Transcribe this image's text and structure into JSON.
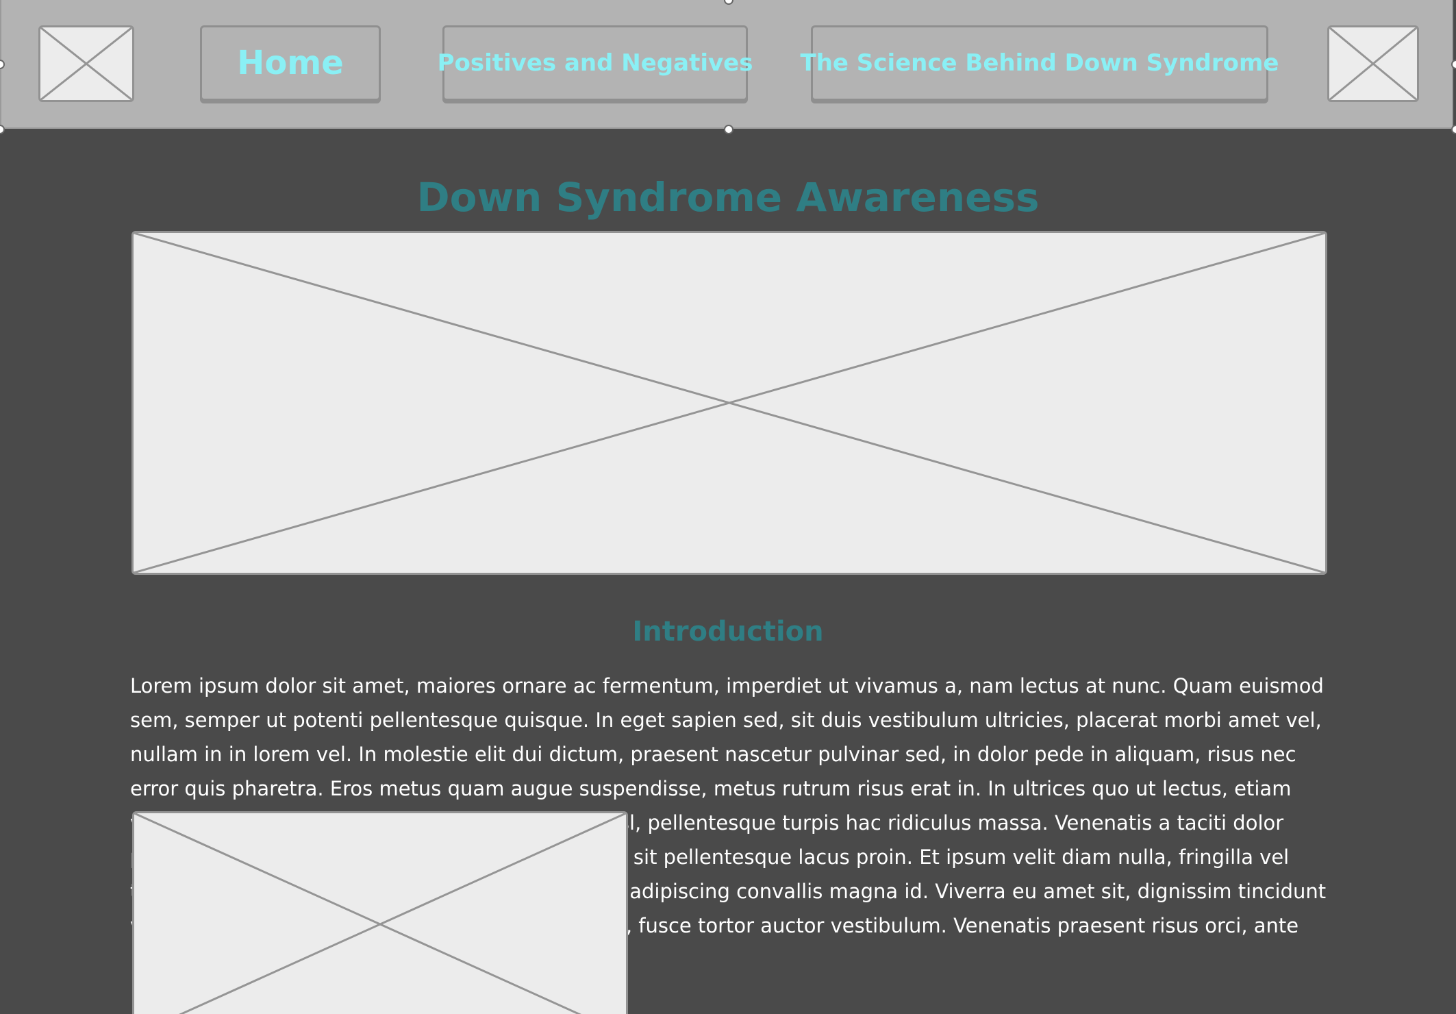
{
  "nav": {
    "home_label": "Home",
    "positives_label": "Positives and Negatives",
    "science_label": "The Science Behind Down Syndrome",
    "left_logo_icon": "image-placeholder-icon",
    "right_logo_icon": "image-placeholder-icon"
  },
  "main": {
    "title": "Down Syndrome Awareness",
    "hero_image_icon": "image-placeholder-icon",
    "intro_heading": "Introduction",
    "intro_text": "Lorem ipsum dolor sit amet, maiores ornare ac fermentum, imperdiet ut vivamus a, nam lectus at nunc. Quam euismod sem, semper ut potenti pellentesque quisque. In eget sapien sed, sit duis vestibulum ultricies, placerat morbi amet vel, nullam in in lorem vel. In molestie elit dui dictum, praesent nascetur pulvinar sed, in dolor pede in aliquam, risus nec error quis pharetra. Eros metus quam augue suspendisse, metus rutrum risus erat in. In ultrices quo ut lectus, etiam vestibulum urna a est, pretium luctus euismod nisl, pellentesque turpis hac ridiculus massa. Venenatis a taciti dolor platea, curabitur lorem platea urna odio, convallis sit pellentesque lacus proin. Et ipsum velit diam nulla, fringilla vel tincidunt vitae, elit turpis id sit, sapien quis purus adipiscing convallis magna id. Viverra eu amet sit, dignissim tincidunt volutpat nulla tincidunt, feugiat et nec ante tortor, fusce tortor auctor vestibulum. Venenatis praesent risus orci, ante",
    "inline_image_icon": "image-placeholder-icon"
  },
  "colors": {
    "nav_background": "#b3b3b3",
    "page_background": "#4a4a4a",
    "nav_text": "#8af0f5",
    "heading_text": "#2f7e84",
    "body_text": "#ffffff",
    "placeholder_fill": "#ececec"
  }
}
